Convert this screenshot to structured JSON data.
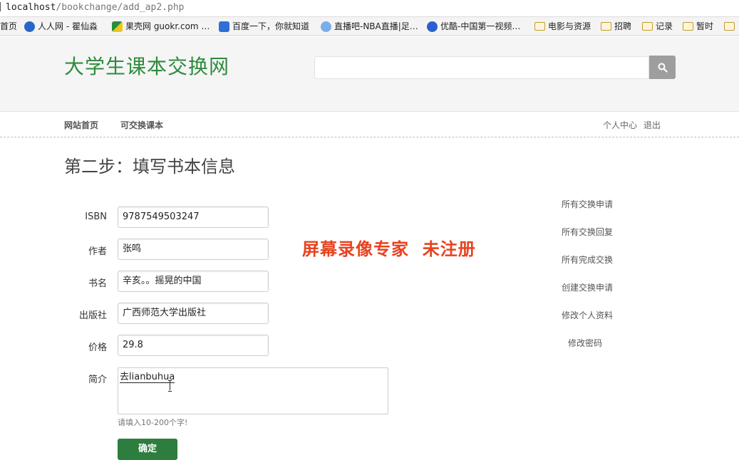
{
  "browser": {
    "url_host": "localhost",
    "url_path": "/bookchange/add_ap2.php",
    "bookmarks": [
      {
        "label": "首页",
        "icon": "none"
      },
      {
        "label": "人人网 - 瞿仙淼",
        "icon": "renren-icon"
      },
      {
        "label": "果壳网 guokr.com …",
        "icon": "guokr-icon"
      },
      {
        "label": "百度一下，你就知道",
        "icon": "baidu-icon"
      },
      {
        "label": "直播吧-NBA直播|足…",
        "icon": "zhibo-icon"
      },
      {
        "label": "优酷-中国第一视频…",
        "icon": "youku-icon"
      },
      {
        "label": "电影与资源",
        "icon": "folder-icon"
      },
      {
        "label": "招聘",
        "icon": "folder-icon"
      },
      {
        "label": "记录",
        "icon": "folder-icon"
      },
      {
        "label": "暂时",
        "icon": "folder-icon"
      }
    ]
  },
  "header": {
    "logo": "大学生课本交换网",
    "search_placeholder": ""
  },
  "nav": {
    "home": "网站首页",
    "books": "可交换课本",
    "profile": "个人中心",
    "logout": "退出"
  },
  "page": {
    "title": "第二步：填写书本信息"
  },
  "form": {
    "isbn_label": "ISBN",
    "isbn_value": "9787549503247",
    "author_label": "作者",
    "author_value": "张鸣",
    "title_label": "书名",
    "title_value": "辛亥。。摇晃的中国",
    "publisher_label": "出版社",
    "publisher_value": "广西师范大学出版社",
    "price_label": "价格",
    "price_value": "29.8",
    "intro_label": "简介",
    "intro_value": "去lianbuhua",
    "hint": "请填入10-200个字!",
    "submit": "确定"
  },
  "watermark": "屏幕录像专家  未注册",
  "sidebar": {
    "items": [
      "所有交换申请",
      "所有交换回复",
      "所有完成交换",
      "创建交换申请",
      "修改个人资料",
      "修改密码"
    ]
  },
  "colors": {
    "brand_green": "#2e8b3d",
    "button_green": "#2d7d3e",
    "watermark_red": "#e8421f"
  }
}
